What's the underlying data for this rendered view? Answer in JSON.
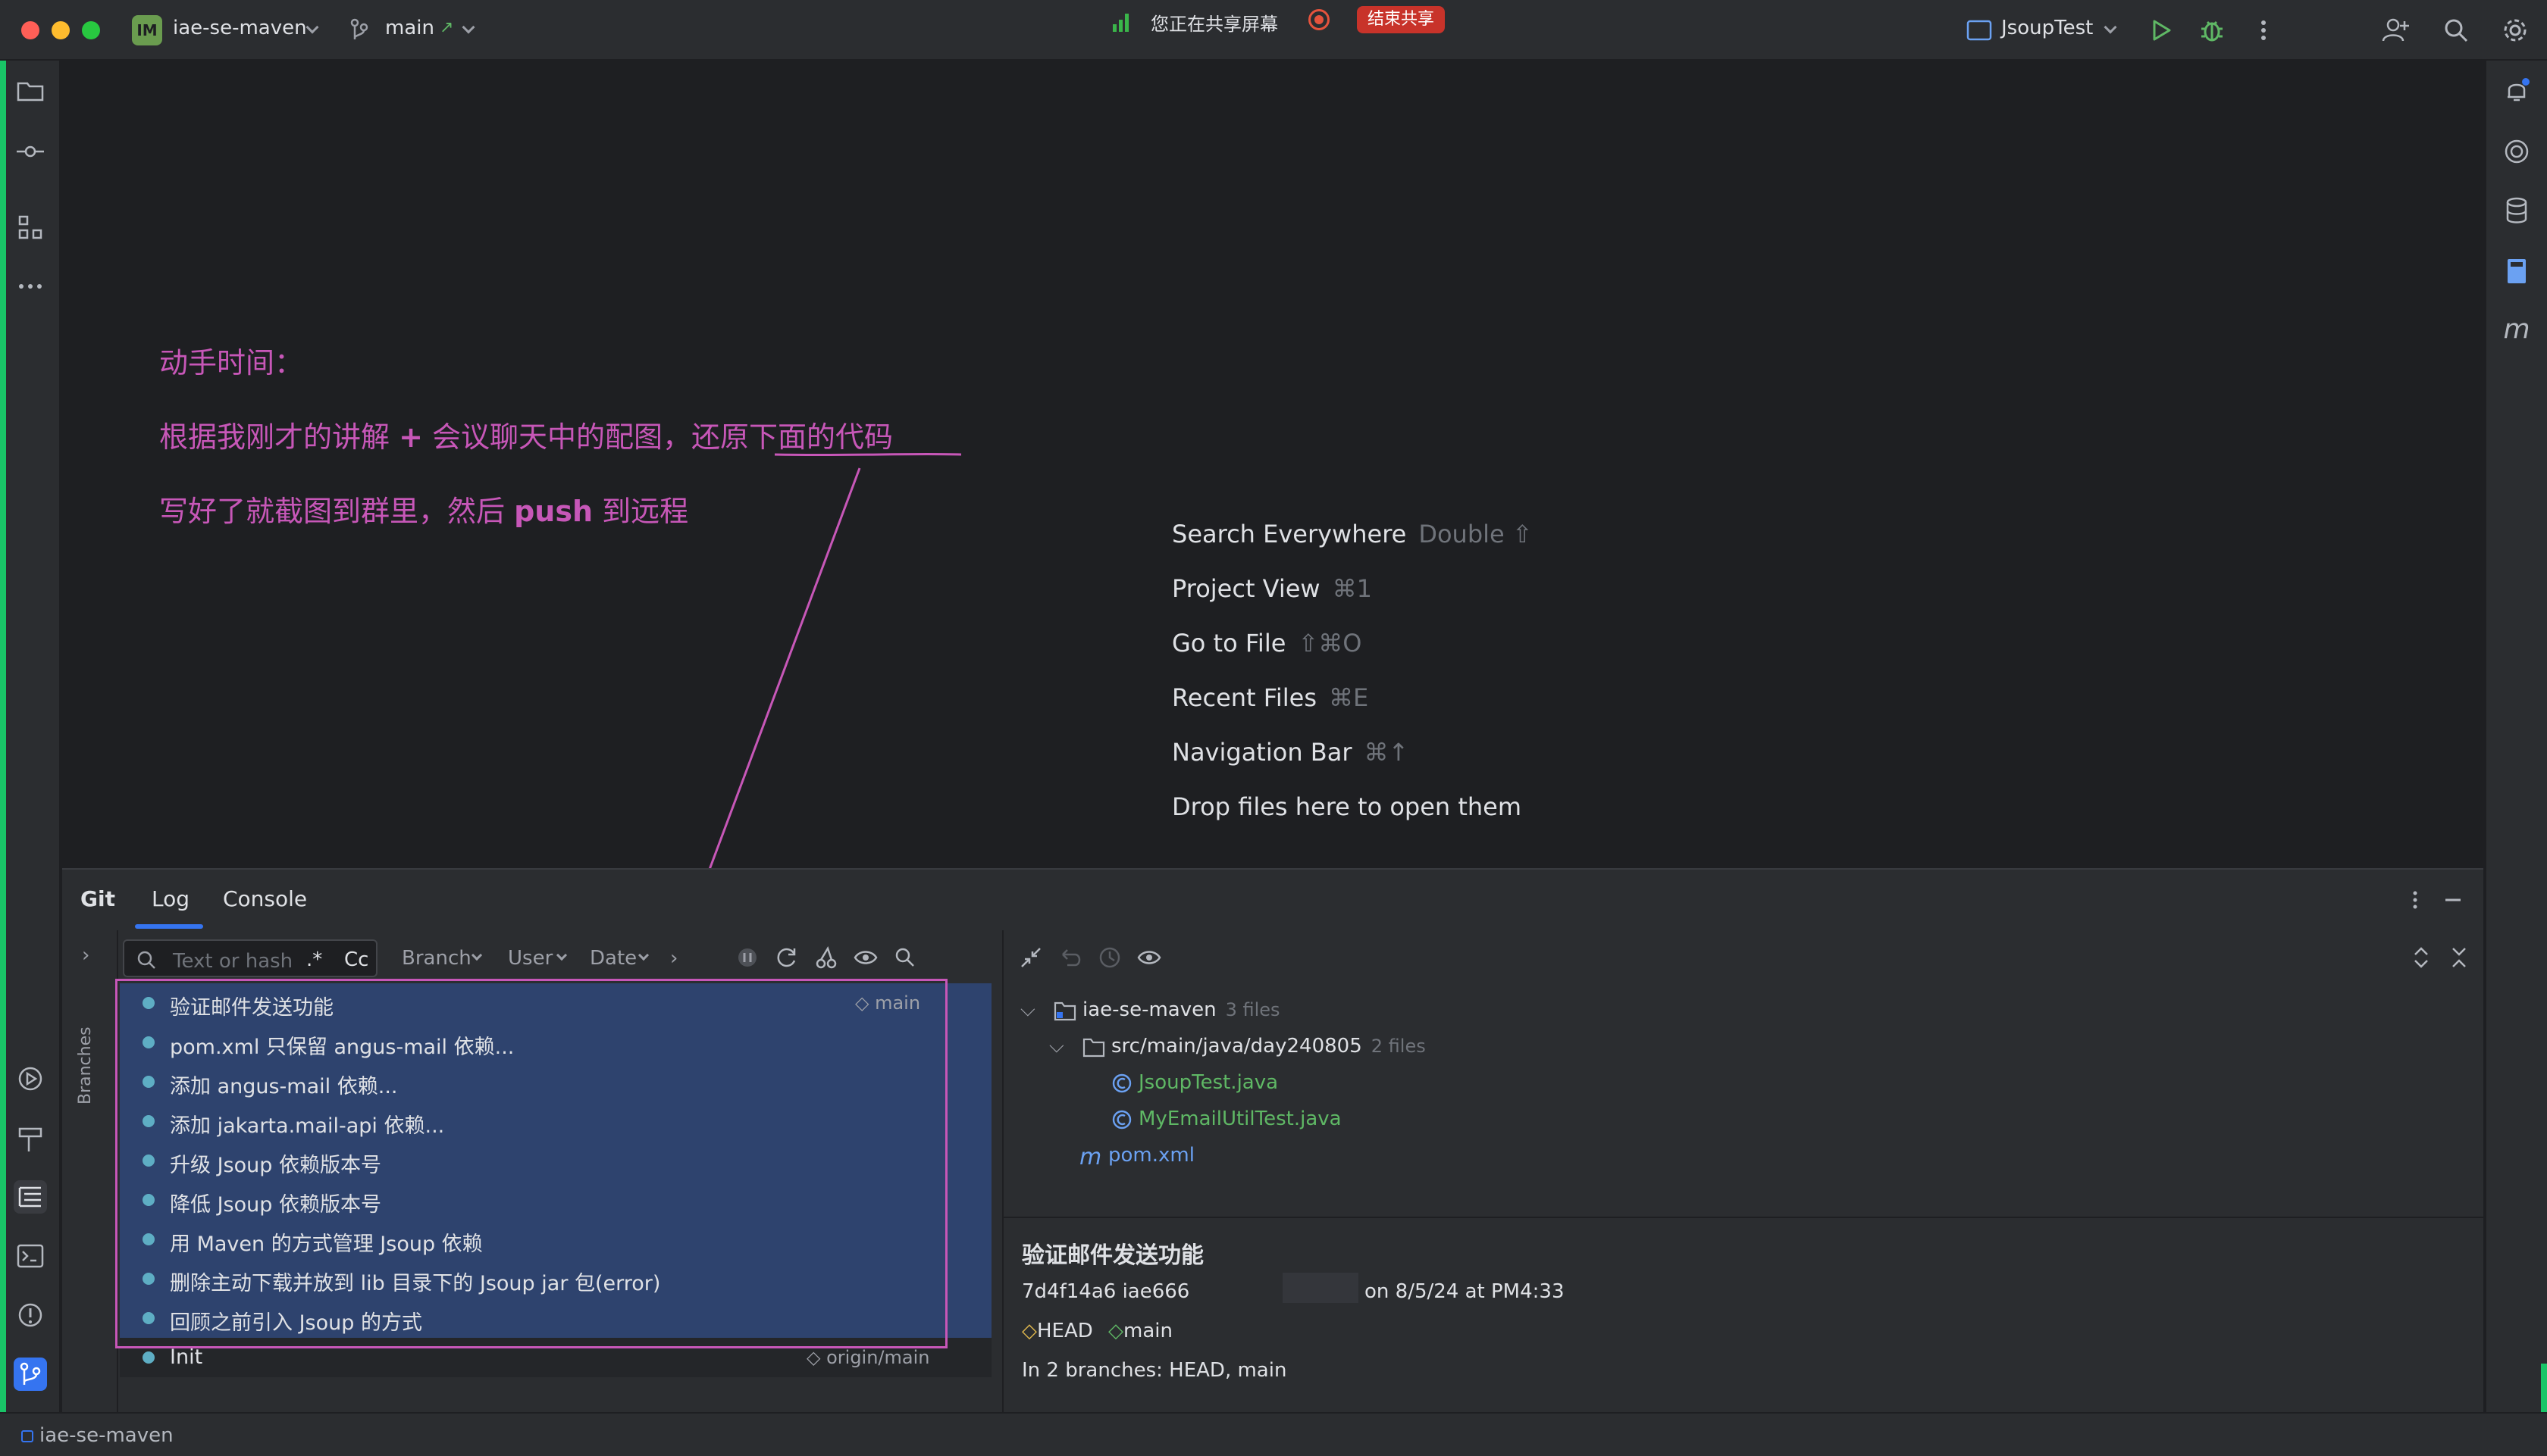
{
  "titlebar": {
    "project_badge": "IM",
    "project_name": "iae-se-maven",
    "branch": "main",
    "sharing_text": "您正在共享屏幕",
    "end_share": "结束共享",
    "run_config": "JsoupTest"
  },
  "annotation": {
    "line1": "动手时间：",
    "line2_a": "根据我刚才的讲解 ",
    "line2_plus": "+",
    "line2_b": " 会议聊天中的配图，还原下面的代码",
    "line3_a": "写好了就截图到群里，然后 ",
    "line3_push": "push",
    "line3_b": " 到远程"
  },
  "hints": [
    {
      "label": "Search Everywhere",
      "key": "Double ⇧"
    },
    {
      "label": "Project View",
      "key": "⌘1"
    },
    {
      "label": "Go to File",
      "key": "⇧⌘O"
    },
    {
      "label": "Recent Files",
      "key": "⌘E"
    },
    {
      "label": "Navigation Bar",
      "key": "⌘↑"
    },
    {
      "label": "Drop files here to open them",
      "key": ""
    }
  ],
  "toolwindow": {
    "tabs": [
      "Git",
      "Log",
      "Console"
    ],
    "active_tab": "Log",
    "branches_label": "Branches"
  },
  "log": {
    "search_placeholder": "Text or hash",
    "regex": ".*",
    "case": "Cc",
    "filters": [
      "Branch",
      "User",
      "Date"
    ],
    "commits": [
      {
        "message": "验证邮件发送功能",
        "ref": "main"
      },
      {
        "message": "pom.xml 只保留 angus-mail 依赖...",
        "ref": ""
      },
      {
        "message": "添加 angus-mail 依赖...",
        "ref": ""
      },
      {
        "message": "添加 jakarta.mail-api 依赖...",
        "ref": ""
      },
      {
        "message": "升级 Jsoup 依赖版本号",
        "ref": ""
      },
      {
        "message": "降低 Jsoup 依赖版本号",
        "ref": ""
      },
      {
        "message": "用 Maven 的方式管理 Jsoup 依赖",
        "ref": ""
      },
      {
        "message": "删除主动下载并放到 lib 目录下的 Jsoup jar 包(error)",
        "ref": ""
      },
      {
        "message": "回顾之前引入 Jsoup 的方式",
        "ref": ""
      },
      {
        "message": "Init",
        "ref": "origin/main"
      }
    ]
  },
  "details": {
    "tree": {
      "root": "iae-se-maven",
      "root_count": "3 files",
      "folder": "src/main/java/day240805",
      "folder_count": "2 files",
      "files": [
        "JsoupTest.java",
        "MyEmailUtilTest.java"
      ],
      "pom": "pom.xml"
    },
    "title": "验证邮件发送功能",
    "hash_line": "7d4f14a6 iae666",
    "date_line": "on 8/5/24 at PM4:33",
    "head": "HEAD",
    "main": "main",
    "branches_line": "In 2 branches: HEAD, main"
  },
  "statusbar": {
    "project": "iae-se-maven"
  },
  "colors": {
    "accent": "#3574f0",
    "annotation": "#c757b8",
    "selection": "#2e436e",
    "graph": "#5eaec4",
    "green_file": "#5fb865"
  }
}
